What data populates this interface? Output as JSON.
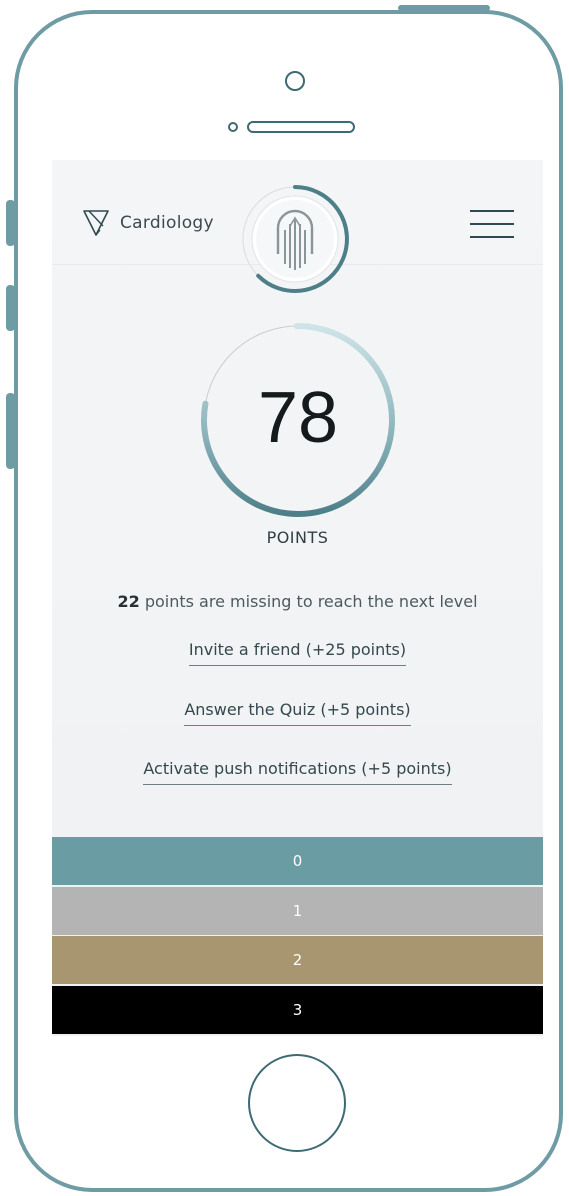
{
  "header": {
    "brand_label": "Cardiology",
    "brand_icon": "v-logo-icon",
    "logo_icon": "building-logo-icon",
    "menu_icon": "hamburger-menu-icon"
  },
  "score": {
    "value": "78",
    "label": "POINTS",
    "progress_fraction": 0.78
  },
  "missing": {
    "count": "22",
    "text": " points are missing to reach the next level"
  },
  "actions": [
    {
      "label": "Invite a friend (+25 points)"
    },
    {
      "label": "Answer the Quiz (+5 points)"
    },
    {
      "label": "Activate push notifications (+5 points)"
    }
  ],
  "levels": [
    {
      "label": "0",
      "color": "#6a9ca3"
    },
    {
      "label": "1",
      "color": "#b4b4b4"
    },
    {
      "label": "2",
      "color": "#a89670"
    },
    {
      "label": "3",
      "color": "#000000"
    }
  ],
  "colors": {
    "accent": "#4d7f88",
    "frame": "#6f9ca4"
  }
}
